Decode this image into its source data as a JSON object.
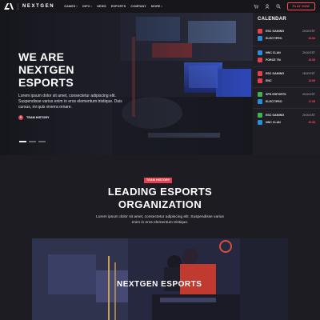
{
  "header": {
    "brand": "NEXTGEN",
    "nav": [
      {
        "label": "GAMES",
        "dropdown": true
      },
      {
        "label": "INFO",
        "dropdown": true
      },
      {
        "label": "NEWS",
        "dropdown": false
      },
      {
        "label": "ESPORTS",
        "dropdown": false
      },
      {
        "label": "COMPANY",
        "dropdown": false
      },
      {
        "label": "MORE",
        "dropdown": true
      }
    ],
    "play_label": "PLAY NOW",
    "icons": [
      "cart-icon",
      "user-icon",
      "search-icon"
    ],
    "accent": "#ff4a57"
  },
  "hero": {
    "title": "WE ARE NEXTGEN ESPORTS",
    "body": "Lorem ipsum dolor sit amet, consectetur adipiscing elit. Suspendisse varius enim in eros elementum tristique. Duis cursus, mi quis viverra ornare.",
    "link": "TEAM HISTORY",
    "slides": 3,
    "active_slide": 1
  },
  "calendar": {
    "title": "CALENDAR",
    "matches": [
      {
        "team1": "ESC GAMING",
        "team1_color": "#e3414d",
        "team2": "ELECT/PRO",
        "team2_color": "#2c8cd8",
        "time": "20:00 EST",
        "date": "03.08"
      },
      {
        "team1": "NNC CLAN",
        "team1_color": "#2c8cd8",
        "team2": "FORCE TM",
        "team2_color": "#e3414d",
        "time": "20:00 EST",
        "date": "10.08"
      },
      {
        "team1": "ESC GAMING",
        "team1_color": "#e3414d",
        "team2": "ENC",
        "team2_color": "#e3414d",
        "time": "18:00 EST",
        "date": "14.08"
      },
      {
        "team1": "SPD ESPORTS",
        "team1_color": "#3fb34f",
        "team2": "ELECT/PRO",
        "team2_color": "#2c8cd8",
        "time": "20:00 EST",
        "date": "17.08"
      },
      {
        "team1": "ESC GAMING",
        "team1_color": "#3fb34f",
        "team2": "NNC CLAN",
        "team2_color": "#2c8cd8",
        "time": "20:00 EST",
        "date": "20.08"
      }
    ]
  },
  "org": {
    "tag": "TEAM HISTORY",
    "title_line1": "LEADING ESPORTS",
    "title_line2": "ORGANIZATION",
    "body": "Lorem ipsum dolor sit amet, consectetur adipiscing elit. Suspendisse varius enim in eros elementum tristique.",
    "video_label": "NEXTGEN ESPORTS"
  }
}
